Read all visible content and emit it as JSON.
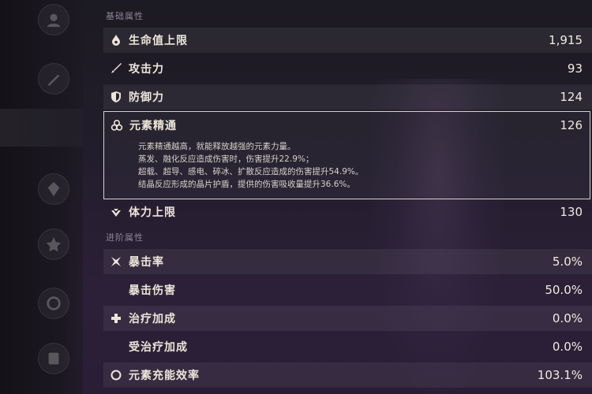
{
  "sections": {
    "base_title": "基础属性",
    "advanced_title": "进阶属性"
  },
  "stats": {
    "hp": {
      "label": "生命值上限",
      "value": "1,915",
      "icon": "drop-icon"
    },
    "atk": {
      "label": "攻击力",
      "value": "93",
      "icon": "sword-icon"
    },
    "def": {
      "label": "防御力",
      "value": "124",
      "icon": "shield-icon"
    },
    "em": {
      "label": "元素精通",
      "value": "126",
      "icon": "element-icon",
      "desc": [
        "元素精通越高，就能释放越强的元素力量。",
        "蒸发、融化反应造成伤害时，伤害提升22.9%；",
        "超载、超导、感电、碎冰、扩散反应造成的伤害提升54.9%。",
        "结晶反应形成的晶片护盾，提供的伤害吸收量提升36.6%。"
      ]
    },
    "stamina": {
      "label": "体力上限",
      "value": "130",
      "icon": "stamina-icon"
    },
    "crit_rate": {
      "label": "暴击率",
      "value": "5.0%",
      "icon": "crit-icon"
    },
    "crit_dmg": {
      "label": "暴击伤害",
      "value": "50.0%"
    },
    "healing": {
      "label": "治疗加成",
      "value": "0.0%",
      "icon": "cross-icon"
    },
    "incoming_healing": {
      "label": "受治疗加成",
      "value": "0.0%"
    },
    "energy_recharge": {
      "label": "元素充能效率",
      "value": "103.1%",
      "icon": "ring-icon"
    }
  },
  "colors": {
    "text": "#ece5d8",
    "section": "#8d8697",
    "highlight_border": "#d7d1c8"
  }
}
